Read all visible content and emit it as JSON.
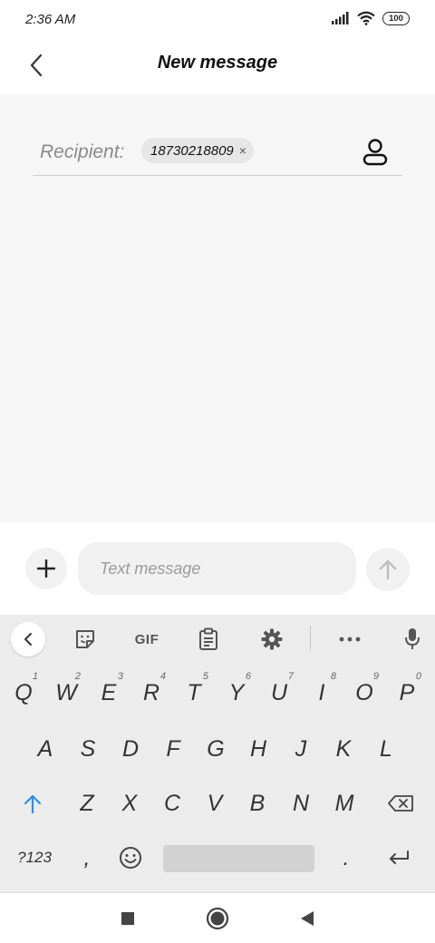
{
  "status_bar": {
    "time": "2:36 AM",
    "battery": "100"
  },
  "header": {
    "title": "New message"
  },
  "recipient": {
    "label": "Recipient:",
    "chip": "18730218809",
    "chip_close": "×"
  },
  "compose": {
    "placeholder": "Text message"
  },
  "keyboard": {
    "toolbar": {
      "gif": "GIF"
    },
    "row1": [
      {
        "k": "Q",
        "h": "1"
      },
      {
        "k": "W",
        "h": "2"
      },
      {
        "k": "E",
        "h": "3"
      },
      {
        "k": "R",
        "h": "4"
      },
      {
        "k": "T",
        "h": "5"
      },
      {
        "k": "Y",
        "h": "6"
      },
      {
        "k": "U",
        "h": "7"
      },
      {
        "k": "I",
        "h": "8"
      },
      {
        "k": "O",
        "h": "9"
      },
      {
        "k": "P",
        "h": "0"
      }
    ],
    "row2": [
      "A",
      "S",
      "D",
      "F",
      "G",
      "H",
      "J",
      "K",
      "L"
    ],
    "row3": [
      "Z",
      "X",
      "C",
      "V",
      "B",
      "N",
      "M"
    ],
    "bottom": {
      "symbols": "?123",
      "comma": ",",
      "period": "."
    }
  },
  "colors": {
    "accent": "#2f8ee5",
    "surface": "#f6f6f6",
    "keyboard_bg": "#ececec"
  }
}
